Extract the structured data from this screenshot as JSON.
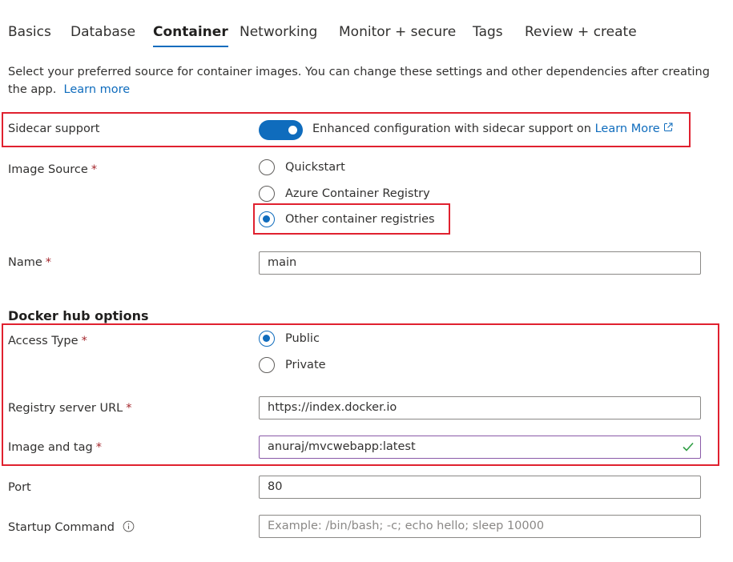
{
  "tabs": [
    {
      "label": "Basics"
    },
    {
      "label": "Database"
    },
    {
      "label": "Container",
      "active": true
    },
    {
      "label": "Networking"
    },
    {
      "label": "Monitor + secure"
    },
    {
      "label": "Tags"
    },
    {
      "label": "Review + create"
    }
  ],
  "description": {
    "text": "Select your preferred source for container images. You can change these settings and other dependencies after creating the app.",
    "learn_more": "Learn more"
  },
  "sidecar": {
    "label": "Sidecar support",
    "toggle_on": true,
    "text": "Enhanced configuration with sidecar support on",
    "link": "Learn More"
  },
  "image_source": {
    "label": "Image Source",
    "required_mark": "*",
    "options": [
      "Quickstart",
      "Azure Container Registry",
      "Other container registries"
    ],
    "selected": "Other container registries"
  },
  "name": {
    "label": "Name",
    "required_mark": "*",
    "value": "main"
  },
  "docker_hub": {
    "title": "Docker hub options",
    "access_type": {
      "label": "Access Type",
      "required_mark": "*",
      "options": [
        "Public",
        "Private"
      ],
      "selected": "Public"
    },
    "registry_url": {
      "label": "Registry server URL",
      "required_mark": "*",
      "value": "https://index.docker.io"
    },
    "image_tag": {
      "label": "Image and tag",
      "required_mark": "*",
      "value": "anuraj/mvcwebapp:latest"
    }
  },
  "port": {
    "label": "Port",
    "value": "80"
  },
  "startup_command": {
    "label": "Startup Command",
    "placeholder": "Example: /bin/bash; -c; echo hello; sleep 10000"
  },
  "colors": {
    "accent": "#0f6cbd",
    "highlight_border": "#e0212f",
    "required": "#a4262c",
    "valid_check": "#2f9e44"
  }
}
